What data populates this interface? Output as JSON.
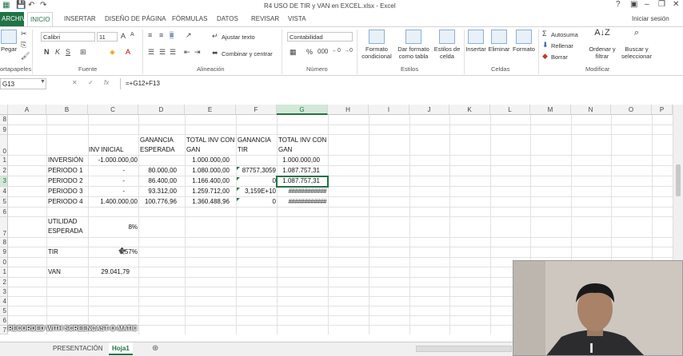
{
  "window": {
    "title": "R4 USO DE TIR y VAN en EXCEL.xlsx - Excel",
    "controls": [
      "?",
      "▣",
      "–",
      "❐",
      "✕"
    ]
  },
  "tabs": [
    "ARCHIVO",
    "INICIO",
    "INSERTAR",
    "DISEÑO DE PÁGINA",
    "FÓRMULAS",
    "DATOS",
    "REVISAR",
    "VISTA"
  ],
  "signin": "Iniciar sesión",
  "ribbon": {
    "paste": "Pegar",
    "clipboard": "ortapapeles",
    "font_name": "Calibri",
    "font_size": "11",
    "font_group": "Fuente",
    "wrap_text": "Ajustar texto",
    "merge_center": "Combinar y centrar",
    "alignment_group": "Alineación",
    "number_format": "Contabilidad",
    "number_group": "Número",
    "cond_format": "Formato condicional",
    "format_table": "Dar formato como tabla",
    "cell_styles": "Estilos de celda",
    "styles_group": "Estilos",
    "insert": "Insertar",
    "delete": "Eliminar",
    "format": "Formato",
    "cells_group": "Celdas",
    "autosum": "Autosuma",
    "fill": "Rellenar",
    "clear": "Borrar",
    "sort_filter": "Ordenar y filtrar",
    "find_select": "Buscar y seleccionar",
    "edit_group": "Modificar",
    "accent": "#217346"
  },
  "formula_bar": {
    "name_box": "G13",
    "formula": "=+G12+F13"
  },
  "columns": [
    "A",
    "B",
    "C",
    "D",
    "E",
    "F",
    "G",
    "H",
    "I",
    "J",
    "K",
    "L",
    "M",
    "N",
    "O",
    "P"
  ],
  "rows": [
    "8",
    "9",
    "0",
    "1",
    "2",
    "3",
    "4",
    "5",
    "6",
    "7",
    "8",
    "9",
    "0",
    "1",
    "2",
    "3",
    "4",
    "5",
    "6",
    "7"
  ],
  "cells": {
    "b1": "INVERSIÓN",
    "c1": "-1.000.000,00",
    "e1": "1.000.000,00",
    "g1": "1.000.000,00",
    "c0": "INV INICIAL",
    "d_hdr1": "GANANCIA",
    "d_hdr2": "ESPERADA",
    "e_hdr1": "TOTAL INV CON",
    "e_hdr2": "GAN",
    "f_hdr1": "GANANCIA",
    "f_hdr2": "TIR",
    "g_hdr1": "TOTAL INV CON",
    "g_hdr2": "GAN",
    "b2": "PERIODO 1",
    "c2": "-",
    "d2": "80.000,00",
    "e2": "1.080.000,00",
    "f2": "87757,3059",
    "g2": "1.087.757,31",
    "b3": "PERIODO 2",
    "c3": "-",
    "d3": "86.400,00",
    "e3": "1.166.400,00",
    "f3": "0",
    "g3": "1.087.757,31",
    "b4": "PERIODO 3",
    "c4": "-",
    "d4": "93.312,00",
    "e4": "1.259.712,00",
    "f4": "3,159E+10",
    "g4": "############",
    "b5": "PERIODO 4",
    "c5": "1.400.000,00",
    "d5": "100.776,96",
    "e5": "1.360.488,96",
    "f5": "0",
    "g5": "############",
    "b7a": "UTILIDAD",
    "b7b": "ESPERADA",
    "c7": "8%",
    "b9": "TIR",
    "c9": "8,57%",
    "b1v": "VAN",
    "c1v": "29.041,79"
  },
  "sheets": [
    "PRESENTACIÓN",
    "Hoja1"
  ],
  "watermark": "RECORDED WITH SCREENCAST-O-MATIC"
}
